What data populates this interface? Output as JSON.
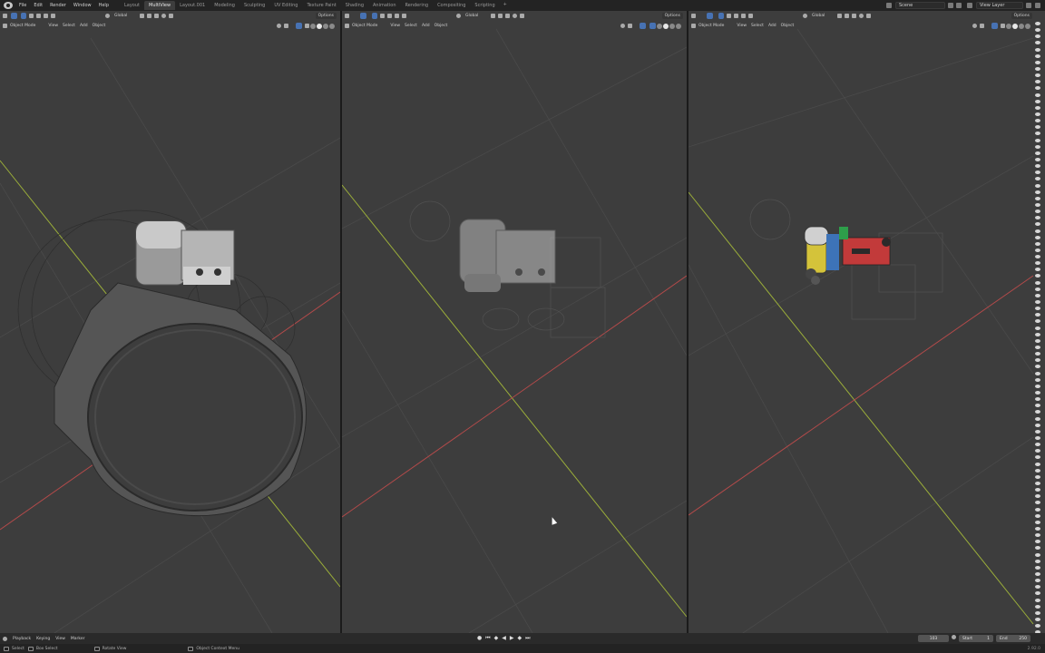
{
  "topbar": {
    "menu": [
      "File",
      "Edit",
      "Render",
      "Window",
      "Help"
    ],
    "workspace_tabs": [
      "Layout",
      "MultiView",
      "Layout.001",
      "Modeling",
      "Sculpting",
      "UV Editing",
      "Texture Paint",
      "Shading",
      "Animation",
      "Rendering",
      "Compositing",
      "Scripting"
    ],
    "active_tab": "MultiView",
    "add_tab": "+",
    "scene": "Scene",
    "view_layer": "View Layer"
  },
  "viewports": [
    {
      "orientation": "Global",
      "mode": "Object Mode",
      "menu": [
        "View",
        "Select",
        "Add",
        "Object"
      ],
      "options": "Options"
    },
    {
      "orientation": "Global",
      "mode": "Object Mode",
      "menu": [
        "View",
        "Select",
        "Add",
        "Object"
      ],
      "options": "Options"
    },
    {
      "orientation": "Global",
      "mode": "Object Mode",
      "menu": [
        "View",
        "Select",
        "Add",
        "Object"
      ],
      "options": "Options"
    }
  ],
  "timeline": {
    "menu": [
      "Playback",
      "Keying",
      "View",
      "Marker"
    ],
    "current_frame": "103",
    "start_label": "Start",
    "start": "1",
    "end_label": "End",
    "end": "250"
  },
  "statusbar": {
    "items": [
      "Select",
      "Box Select",
      "Rotate View",
      "Object Context Menu"
    ],
    "version": "2.92.0"
  },
  "colors": {
    "viewport_bg": "#3d3d3d",
    "x_axis": "#b34a4a",
    "y_axis": "#9bae3a",
    "accent": "#4772b3"
  }
}
